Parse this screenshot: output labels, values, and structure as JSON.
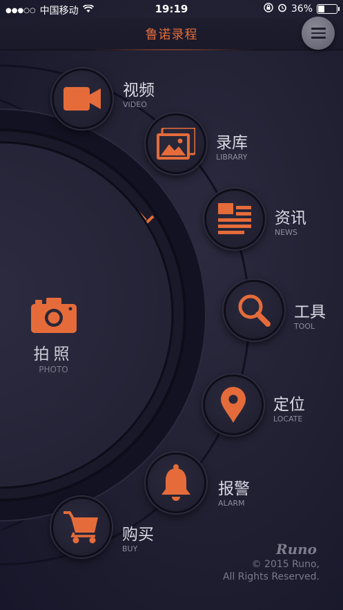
{
  "status_bar": {
    "signal_dots": "●●●○○",
    "carrier": "中国移动",
    "time": "19:19",
    "battery": "36%",
    "battery_level": 0.36
  },
  "header": {
    "title": "鲁诺录程",
    "menu_icon": "hamburger-icon"
  },
  "photo": {
    "label": "拍照",
    "sublabel": "PHOTO",
    "icon": "camera-icon"
  },
  "nav_items": [
    {
      "key": "video",
      "label": "视频",
      "sublabel": "VIDEO",
      "icon": "video-camera-icon"
    },
    {
      "key": "library",
      "label": "录库",
      "sublabel": "LIBRARY",
      "icon": "gallery-icon"
    },
    {
      "key": "news",
      "label": "资讯",
      "sublabel": "NEWS",
      "icon": "news-icon"
    },
    {
      "key": "tool",
      "label": "工具",
      "sublabel": "TOOL",
      "icon": "magnifier-icon"
    },
    {
      "key": "locate",
      "label": "定位",
      "sublabel": "LOCATE",
      "icon": "location-pin-icon"
    },
    {
      "key": "alarm",
      "label": "报警",
      "sublabel": "ALARM",
      "icon": "bell-icon"
    },
    {
      "key": "buy",
      "label": "购买",
      "sublabel": "BUY",
      "icon": "cart-icon"
    }
  ],
  "footer": {
    "brand": "Runo",
    "copyright_line1": "© 2015 Runo,",
    "copyright_line2": "All Rights Reserved."
  },
  "colors": {
    "accent": "#e56c3a",
    "background": "#201f31",
    "button_ring": "#0f0e18"
  }
}
